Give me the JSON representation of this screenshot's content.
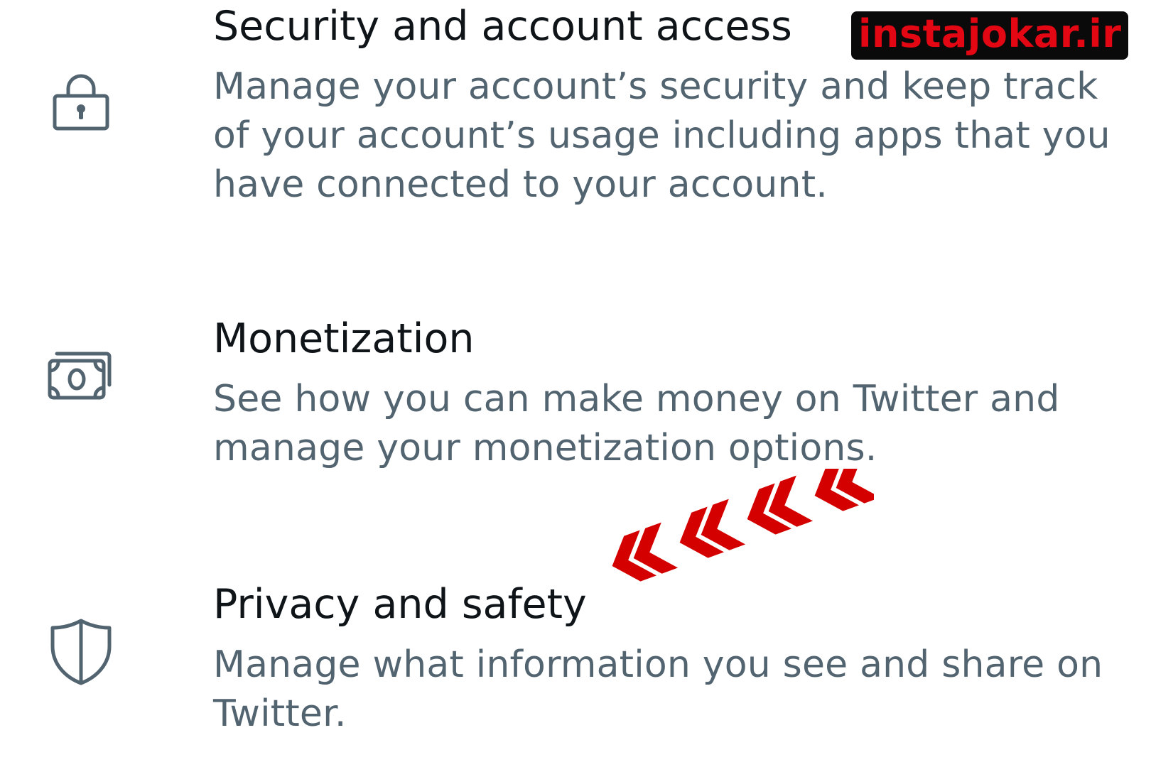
{
  "settings": {
    "items": [
      {
        "id": "security",
        "icon": "lock-icon",
        "title": "Security and account access",
        "description": "Manage your account’s security and keep track of your account’s usage including apps that you have connected to your account."
      },
      {
        "id": "monetization",
        "icon": "money-icon",
        "title": "Monetization",
        "description": "See how you can make money on Twitter and manage your monetization options."
      },
      {
        "id": "privacy",
        "icon": "shield-icon",
        "title": "Privacy and safety",
        "description": "Manage what information you see and share on Twitter."
      }
    ]
  },
  "watermark": {
    "text": "instajokar.ir"
  },
  "annotation": {
    "icon": "red-chevron-arrows-icon",
    "color": "#d40000"
  },
  "colors": {
    "title": "#0f1419",
    "description": "#536471",
    "icon": "#536471"
  }
}
